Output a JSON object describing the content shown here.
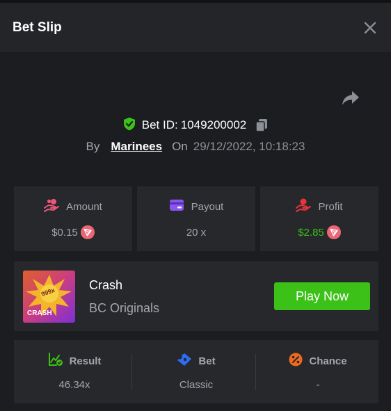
{
  "header": {
    "title": "Bet Slip"
  },
  "bet": {
    "id_label": "Bet ID:",
    "id_value": "1049200002",
    "by_label": "By",
    "user": "Marinees",
    "on_label": "On",
    "datetime": "29/12/2022, 10:18:23"
  },
  "stats": {
    "amount": {
      "label": "Amount",
      "value": "$0.15"
    },
    "payout": {
      "label": "Payout",
      "value": "20 x"
    },
    "profit": {
      "label": "Profit",
      "value": "$2.85"
    }
  },
  "game": {
    "name": "Crash",
    "provider": "BC Originals",
    "thumb_badge": "999x",
    "thumb_title": "CRASH",
    "play_label": "Play Now"
  },
  "result": {
    "result": {
      "label": "Result",
      "value": "46.34x"
    },
    "bet": {
      "label": "Bet",
      "value": "Classic"
    },
    "chance": {
      "label": "Chance",
      "value": "-"
    }
  },
  "colors": {
    "accent_green": "#3bc117",
    "coin": "#ed6675",
    "background": "#1b1d20",
    "card": "#26282c"
  },
  "icons": {
    "close": "close-icon",
    "share": "share-icon",
    "verified": "shield-check-icon",
    "copy": "copy-icon",
    "amount": "hand-coins-icon",
    "payout": "card-icon",
    "profit": "hand-coin-icon",
    "coin": "tron-coin-icon",
    "result": "chart-check-icon",
    "bet": "ticket-icon",
    "chance": "percent-icon"
  }
}
